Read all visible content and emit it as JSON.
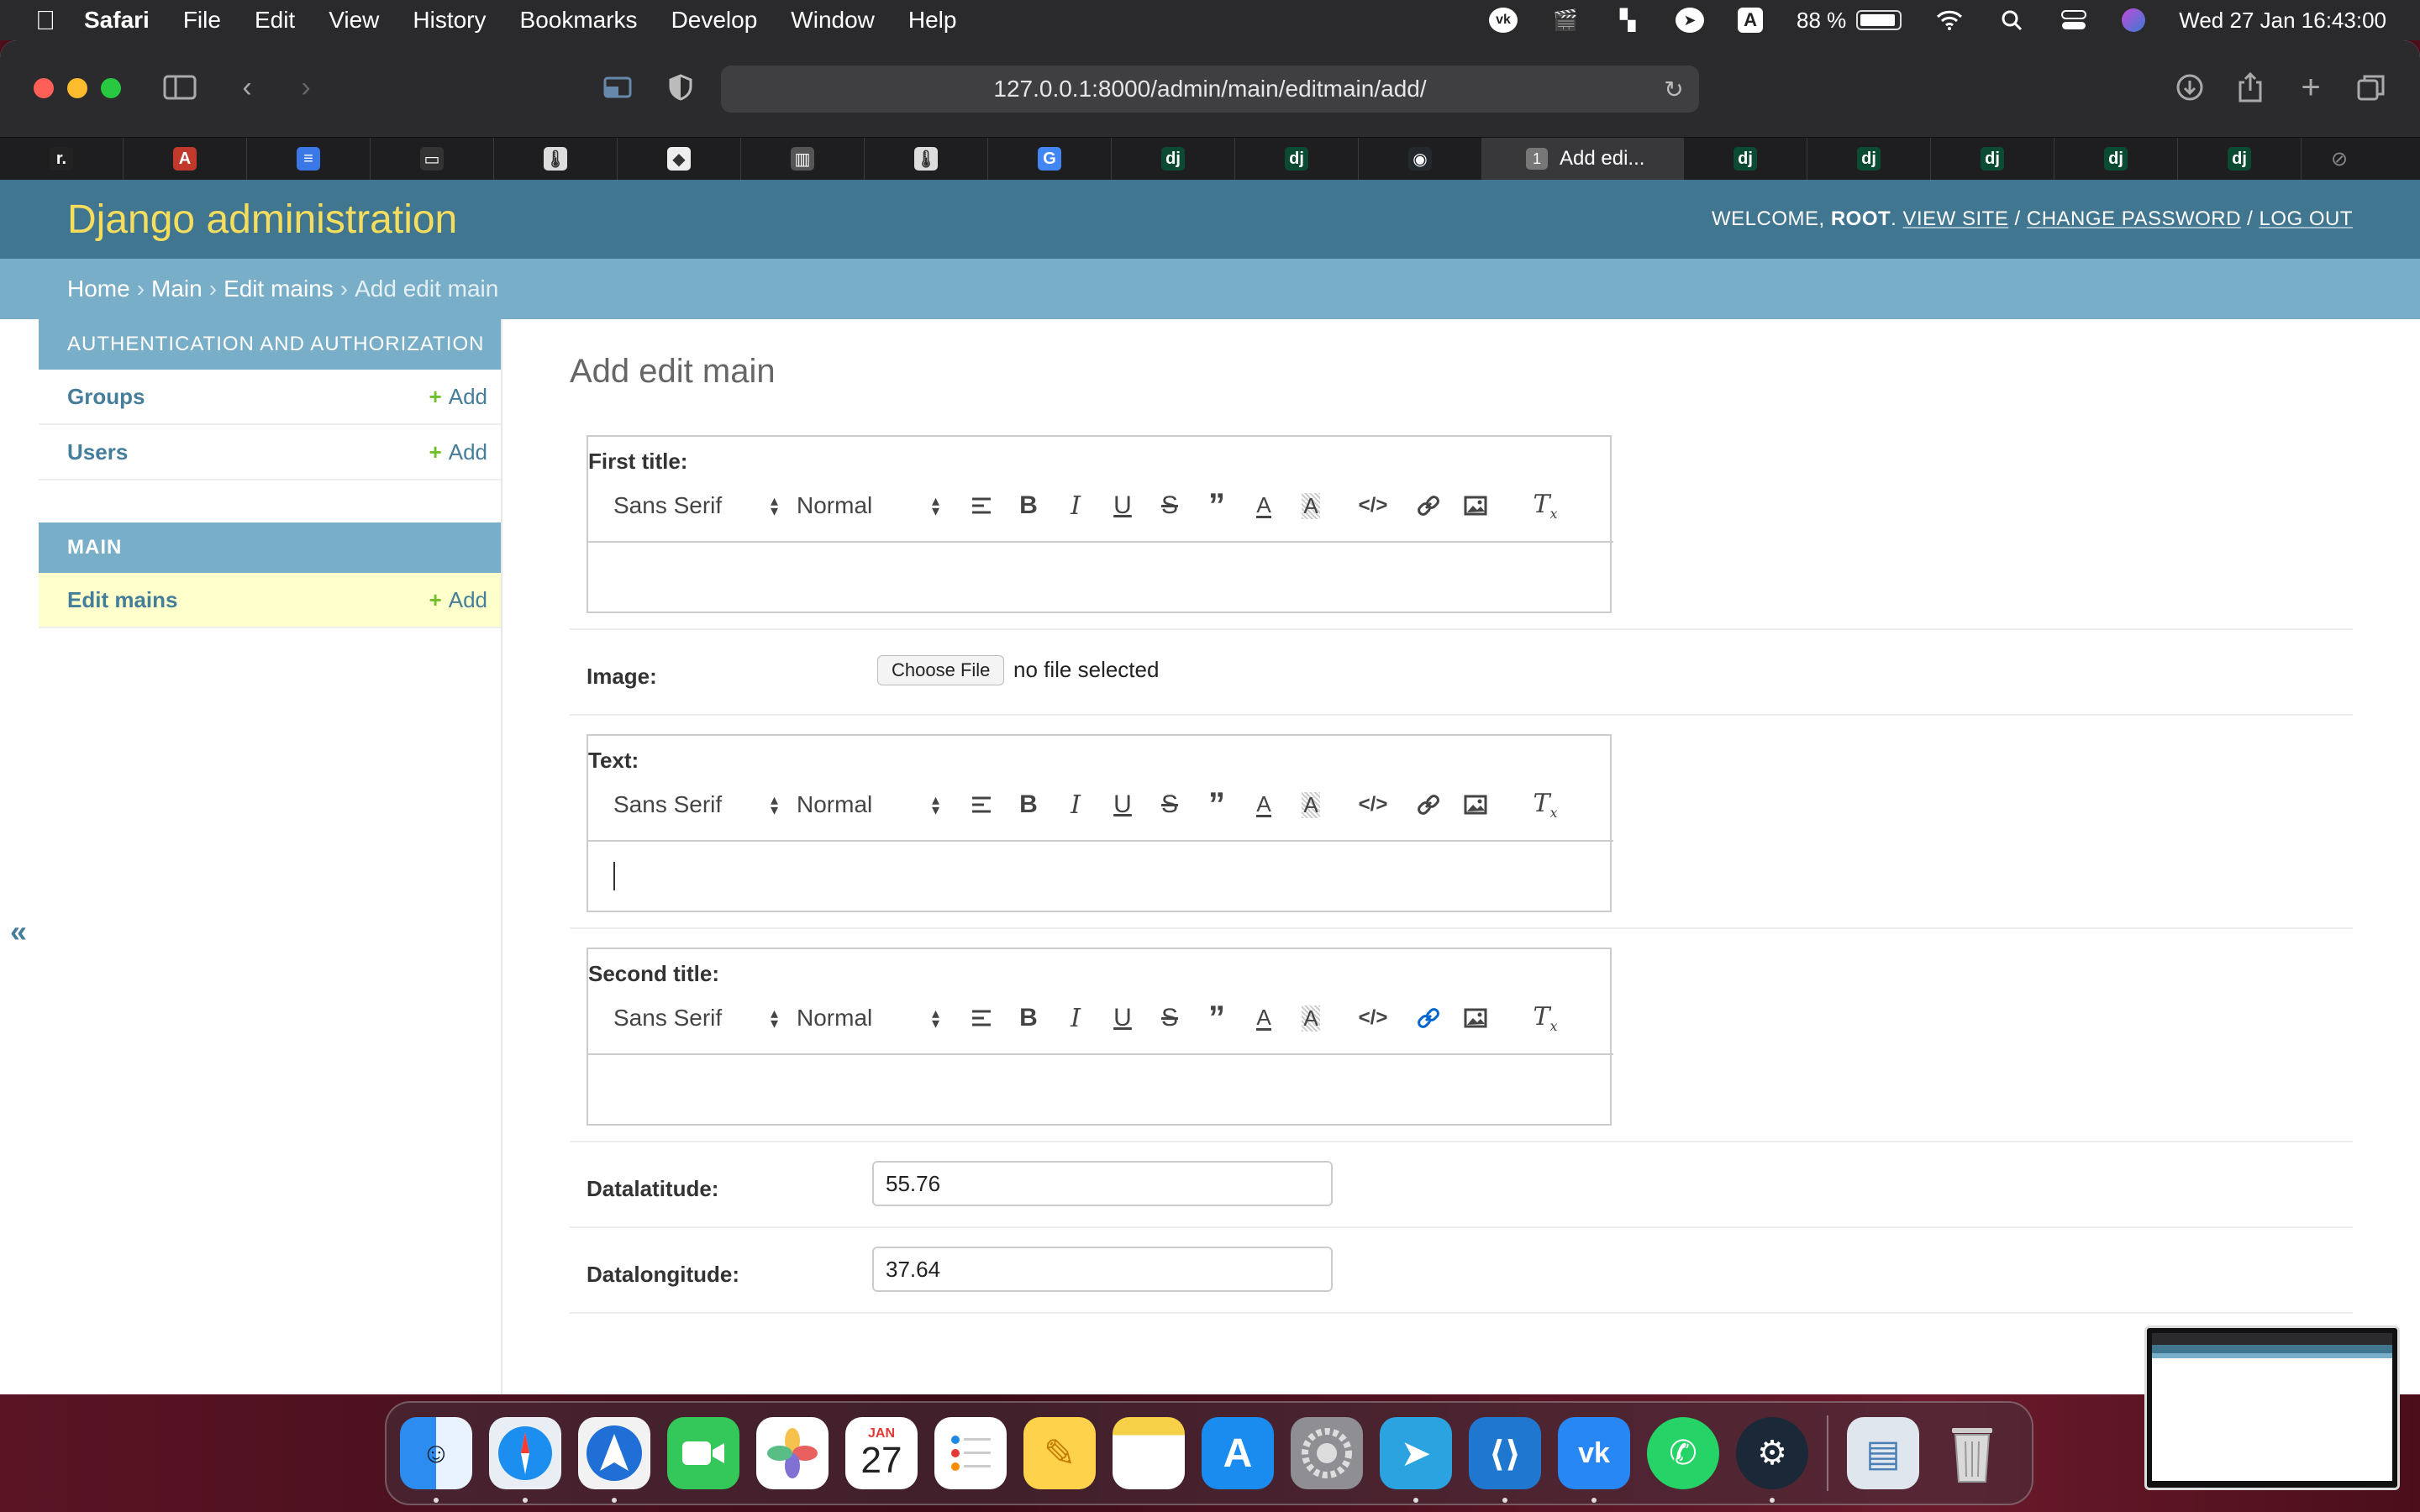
{
  "menubar": {
    "app": "Safari",
    "items": [
      "File",
      "Edit",
      "View",
      "History",
      "Bookmarks",
      "Develop",
      "Window",
      "Help"
    ],
    "battery": "88 %",
    "clock": "Wed 27 Jan  16:43:00"
  },
  "browser": {
    "url": "127.0.0.1:8000/admin/main/editmain/add/",
    "active_tab": {
      "number": "1",
      "label": "Add edi..."
    },
    "tabs_before": [
      {
        "icon": "r.",
        "color": "#222222"
      },
      {
        "icon": "A",
        "color": "#c0392b"
      },
      {
        "icon": "≡",
        "color": "#3b78e7"
      },
      {
        "icon": "▭",
        "color": "#333333"
      },
      {
        "icon": "🌡",
        "color": "#dddddd"
      },
      {
        "icon": "◆",
        "color": "#eeeeee"
      },
      {
        "icon": "▥",
        "color": "#555555"
      },
      {
        "icon": "🌡",
        "color": "#dddddd"
      },
      {
        "icon": "G",
        "color": "#4285f4"
      },
      {
        "icon": "dj",
        "color": "#0c4b33"
      },
      {
        "icon": "dj",
        "color": "#0c4b33"
      },
      {
        "icon": "◉",
        "color": "#24292e"
      }
    ],
    "tabs_after": [
      "dj",
      "dj",
      "dj",
      "dj",
      "dj"
    ]
  },
  "django": {
    "brand": "Django administration",
    "welcome": "Welcome, ",
    "username": "root",
    "view_site": "View site",
    "change_password": "Change password",
    "log_out": "Log out",
    "breadcrumbs": {
      "home": "Home",
      "app": "Main",
      "model": "Edit mains",
      "current": "Add edit main"
    }
  },
  "sidebar": {
    "auth_caption": "Authentication and Authorization",
    "groups": "Groups",
    "users": "Users",
    "main_caption": "Main",
    "edit_mains": "Edit mains",
    "add_label": "Add",
    "collapse": "«"
  },
  "form": {
    "title": "Add edit main",
    "first_title_label": "First title:",
    "image_label": "Image:",
    "choose_file": "Choose File",
    "no_file": "no file selected",
    "text_label": "Text:",
    "second_title_label": "Second title:",
    "lat_label": "Datalatitude:",
    "lat_value": "55.76",
    "lon_label": "Datalongitude:",
    "lon_value": "37.64",
    "font_picker": "Sans Serif",
    "size_picker": "Normal"
  },
  "dock": {
    "calendar_month": "JAN",
    "calendar_day": "27",
    "accent": "#417690"
  }
}
